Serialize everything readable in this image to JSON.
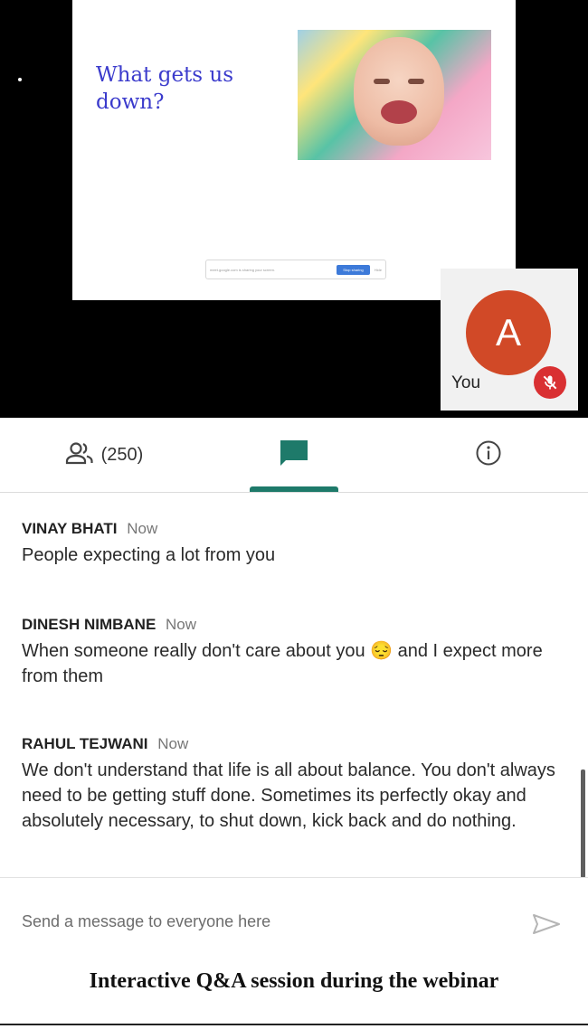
{
  "presentation": {
    "slide_title": "What gets us\ndown?",
    "sharing_bar": {
      "message": "meet.google.com is sharing your screen.",
      "stop_label": "Stop sharing",
      "hide_label": "Hide"
    }
  },
  "self_tile": {
    "avatar_letter": "A",
    "name": "You",
    "avatar_color": "#d14927",
    "mic_status_icon": "mic-off-icon"
  },
  "tabs": {
    "people_count": "(250)",
    "people_icon": "people-icon",
    "chat_icon": "chat-bubble-icon",
    "info_icon": "info-icon",
    "active": "chat",
    "accent_color": "#1e7a6a"
  },
  "chat": {
    "messages": [
      {
        "author": "VINAY BHATI",
        "time": "Now",
        "text": "People expecting a lot from you"
      },
      {
        "author": "DINESH NIMBANE",
        "time": "Now",
        "text": "When someone really don't care about you 😔 and I expect more from them"
      },
      {
        "author": "RAHUL TEJWANI",
        "time": "Now",
        "text": "We don't understand that life is all about balance. You don't always need to be getting stuff done. Sometimes its perfectly okay and absolutely necessary, to shut down, kick back and do nothing."
      }
    ]
  },
  "composer": {
    "placeholder": "Send a message to everyone here",
    "send_icon": "send-icon"
  },
  "caption": "Interactive Q&A session during the webinar"
}
